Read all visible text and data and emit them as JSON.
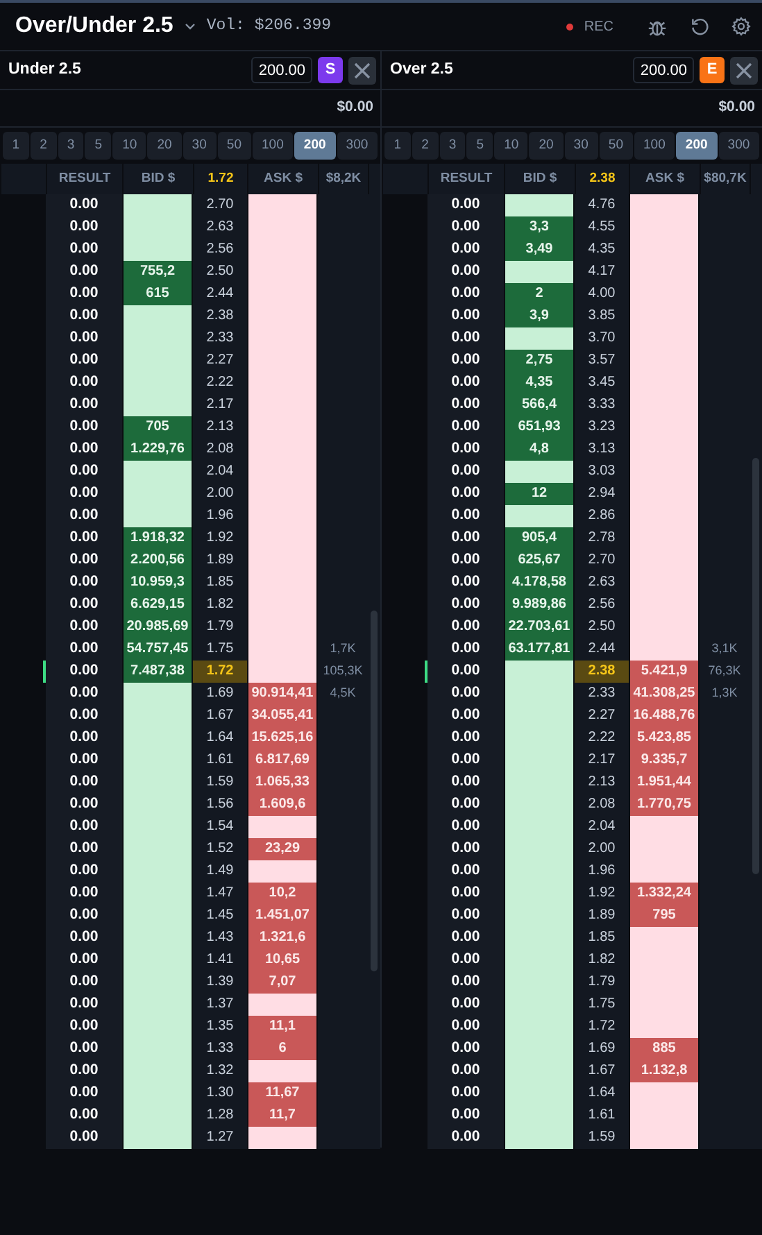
{
  "header": {
    "title": "Over/Under 2.5",
    "volume": "Vol: $206.399",
    "rec": "REC"
  },
  "panels": [
    {
      "name": "Under 2.5",
      "stake": "200.00",
      "badge": "S",
      "color": "#7c3aed",
      "balance": "$0.00",
      "stakes": [
        {
          "label": "1",
          "selected": false
        },
        {
          "label": "2",
          "selected": false
        },
        {
          "label": "3",
          "selected": false
        },
        {
          "label": "5",
          "selected": false
        },
        {
          "label": "10",
          "selected": false
        },
        {
          "label": "20",
          "selected": false
        },
        {
          "label": "30",
          "selected": false
        },
        {
          "label": "50",
          "selected": false
        },
        {
          "label": "100",
          "selected": false
        },
        {
          "label": "200",
          "selected": true
        },
        {
          "label": "300",
          "selected": false
        }
      ],
      "columns": [
        "RESULT",
        "BID $",
        "1.72",
        "ASK $",
        "$8,2K"
      ],
      "rows": [
        {
          "result": "0.00",
          "price": "2.70",
          "current": false
        },
        {
          "result": "0.00",
          "price": "2.63",
          "current": false
        },
        {
          "result": "0.00",
          "price": "2.56",
          "current": false
        },
        {
          "result": "0.00",
          "bid": "755,2",
          "price": "2.50",
          "current": false
        },
        {
          "result": "0.00",
          "bid": "615",
          "price": "2.44",
          "current": false
        },
        {
          "result": "0.00",
          "price": "2.38",
          "current": false
        },
        {
          "result": "0.00",
          "price": "2.33",
          "current": false
        },
        {
          "result": "0.00",
          "price": "2.27",
          "current": false
        },
        {
          "result": "0.00",
          "price": "2.22",
          "current": false
        },
        {
          "result": "0.00",
          "price": "2.17",
          "current": false
        },
        {
          "result": "0.00",
          "bid": "705",
          "price": "2.13",
          "current": false
        },
        {
          "result": "0.00",
          "bid": "1.229,76",
          "price": "2.08",
          "current": false
        },
        {
          "result": "0.00",
          "price": "2.04",
          "current": false
        },
        {
          "result": "0.00",
          "price": "2.00",
          "current": false
        },
        {
          "result": "0.00",
          "price": "1.96",
          "current": false
        },
        {
          "result": "0.00",
          "bid": "1.918,32",
          "price": "1.92",
          "current": false
        },
        {
          "result": "0.00",
          "bid": "2.200,56",
          "price": "1.89",
          "current": false
        },
        {
          "result": "0.00",
          "bid": "10.959,3",
          "price": "1.85",
          "current": false
        },
        {
          "result": "0.00",
          "bid": "6.629,15",
          "price": "1.82",
          "current": false
        },
        {
          "result": "0.00",
          "bid": "20.985,69",
          "price": "1.79",
          "current": false
        },
        {
          "result": "0.00",
          "bid": "54.757,45",
          "price": "1.75",
          "volume": "1,7K",
          "current": false
        },
        {
          "result": "0.00",
          "bid": "7.487,38",
          "price": "1.72",
          "volume": "105,3K",
          "current": true
        },
        {
          "result": "0.00",
          "price": "1.69",
          "ask": "90.914,41",
          "volume": "4,5K",
          "current": false
        },
        {
          "result": "0.00",
          "price": "1.67",
          "ask": "34.055,41",
          "current": false
        },
        {
          "result": "0.00",
          "price": "1.64",
          "ask": "15.625,16",
          "current": false
        },
        {
          "result": "0.00",
          "price": "1.61",
          "ask": "6.817,69",
          "current": false
        },
        {
          "result": "0.00",
          "price": "1.59",
          "ask": "1.065,33",
          "current": false
        },
        {
          "result": "0.00",
          "price": "1.56",
          "ask": "1.609,6",
          "current": false
        },
        {
          "result": "0.00",
          "price": "1.54",
          "current": false
        },
        {
          "result": "0.00",
          "price": "1.52",
          "ask": "23,29",
          "current": false
        },
        {
          "result": "0.00",
          "price": "1.49",
          "current": false
        },
        {
          "result": "0.00",
          "price": "1.47",
          "ask": "10,2",
          "current": false
        },
        {
          "result": "0.00",
          "price": "1.45",
          "ask": "1.451,07",
          "current": false
        },
        {
          "result": "0.00",
          "price": "1.43",
          "ask": "1.321,6",
          "current": false
        },
        {
          "result": "0.00",
          "price": "1.41",
          "ask": "10,65",
          "current": false
        },
        {
          "result": "0.00",
          "price": "1.39",
          "ask": "7,07",
          "current": false
        },
        {
          "result": "0.00",
          "price": "1.37",
          "current": false
        },
        {
          "result": "0.00",
          "price": "1.35",
          "ask": "11,1",
          "current": false
        },
        {
          "result": "0.00",
          "price": "1.33",
          "ask": "6",
          "current": false
        },
        {
          "result": "0.00",
          "price": "1.32",
          "current": false
        },
        {
          "result": "0.00",
          "price": "1.30",
          "ask": "11,67",
          "current": false
        },
        {
          "result": "0.00",
          "price": "1.28",
          "ask": "11,7",
          "current": false
        },
        {
          "result": "0.00",
          "price": "1.27",
          "current": false
        }
      ]
    },
    {
      "name": "Over 2.5",
      "stake": "200.00",
      "badge": "E",
      "color": "#f97316",
      "balance": "$0.00",
      "stakes": [
        {
          "label": "1",
          "selected": false
        },
        {
          "label": "2",
          "selected": false
        },
        {
          "label": "3",
          "selected": false
        },
        {
          "label": "5",
          "selected": false
        },
        {
          "label": "10",
          "selected": false
        },
        {
          "label": "20",
          "selected": false
        },
        {
          "label": "30",
          "selected": false
        },
        {
          "label": "50",
          "selected": false
        },
        {
          "label": "100",
          "selected": false
        },
        {
          "label": "200",
          "selected": true
        },
        {
          "label": "300",
          "selected": false
        }
      ],
      "columns": [
        "RESULT",
        "BID $",
        "2.38",
        "ASK $",
        "$80,7K"
      ],
      "rows": [
        {
          "result": "0.00",
          "price": "4.76",
          "current": false
        },
        {
          "result": "0.00",
          "bid": "3,3",
          "price": "4.55",
          "current": false
        },
        {
          "result": "0.00",
          "bid": "3,49",
          "price": "4.35",
          "current": false
        },
        {
          "result": "0.00",
          "price": "4.17",
          "current": false
        },
        {
          "result": "0.00",
          "bid": "2",
          "price": "4.00",
          "current": false
        },
        {
          "result": "0.00",
          "bid": "3,9",
          "price": "3.85",
          "current": false
        },
        {
          "result": "0.00",
          "price": "3.70",
          "current": false
        },
        {
          "result": "0.00",
          "bid": "2,75",
          "price": "3.57",
          "current": false
        },
        {
          "result": "0.00",
          "bid": "4,35",
          "price": "3.45",
          "current": false
        },
        {
          "result": "0.00",
          "bid": "566,4",
          "price": "3.33",
          "current": false
        },
        {
          "result": "0.00",
          "bid": "651,93",
          "price": "3.23",
          "current": false
        },
        {
          "result": "0.00",
          "bid": "4,8",
          "price": "3.13",
          "current": false
        },
        {
          "result": "0.00",
          "price": "3.03",
          "current": false
        },
        {
          "result": "0.00",
          "bid": "12",
          "price": "2.94",
          "current": false
        },
        {
          "result": "0.00",
          "price": "2.86",
          "current": false
        },
        {
          "result": "0.00",
          "bid": "905,4",
          "price": "2.78",
          "current": false
        },
        {
          "result": "0.00",
          "bid": "625,67",
          "price": "2.70",
          "current": false
        },
        {
          "result": "0.00",
          "bid": "4.178,58",
          "price": "2.63",
          "current": false
        },
        {
          "result": "0.00",
          "bid": "9.989,86",
          "price": "2.56",
          "current": false
        },
        {
          "result": "0.00",
          "bid": "22.703,61",
          "price": "2.50",
          "current": false
        },
        {
          "result": "0.00",
          "bid": "63.177,81",
          "price": "2.44",
          "volume": "3,1K",
          "current": false
        },
        {
          "result": "0.00",
          "price": "2.38",
          "ask": "5.421,9",
          "volume": "76,3K",
          "current": true
        },
        {
          "result": "0.00",
          "price": "2.33",
          "ask": "41.308,25",
          "volume": "1,3K",
          "current": false
        },
        {
          "result": "0.00",
          "price": "2.27",
          "ask": "16.488,76",
          "current": false
        },
        {
          "result": "0.00",
          "price": "2.22",
          "ask": "5.423,85",
          "current": false
        },
        {
          "result": "0.00",
          "price": "2.17",
          "ask": "9.335,7",
          "current": false
        },
        {
          "result": "0.00",
          "price": "2.13",
          "ask": "1.951,44",
          "current": false
        },
        {
          "result": "0.00",
          "price": "2.08",
          "ask": "1.770,75",
          "current": false
        },
        {
          "result": "0.00",
          "price": "2.04",
          "current": false
        },
        {
          "result": "0.00",
          "price": "2.00",
          "current": false
        },
        {
          "result": "0.00",
          "price": "1.96",
          "current": false
        },
        {
          "result": "0.00",
          "price": "1.92",
          "ask": "1.332,24",
          "current": false
        },
        {
          "result": "0.00",
          "price": "1.89",
          "ask": "795",
          "current": false
        },
        {
          "result": "0.00",
          "price": "1.85",
          "current": false
        },
        {
          "result": "0.00",
          "price": "1.82",
          "current": false
        },
        {
          "result": "0.00",
          "price": "1.79",
          "current": false
        },
        {
          "result": "0.00",
          "price": "1.75",
          "current": false
        },
        {
          "result": "0.00",
          "price": "1.72",
          "current": false
        },
        {
          "result": "0.00",
          "price": "1.69",
          "ask": "885",
          "current": false
        },
        {
          "result": "0.00",
          "price": "1.67",
          "ask": "1.132,8",
          "current": false
        },
        {
          "result": "0.00",
          "price": "1.64",
          "current": false
        },
        {
          "result": "0.00",
          "price": "1.61",
          "current": false
        },
        {
          "result": "0.00",
          "price": "1.59",
          "current": false
        }
      ]
    }
  ]
}
